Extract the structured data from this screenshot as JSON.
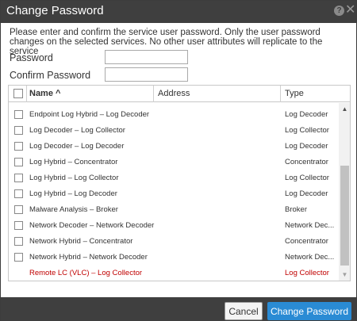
{
  "dialog": {
    "title": "Change Password",
    "intro": "Please enter and confirm the service user password. Only the user password changes on the selected services. No other user attributes will replicate to the service",
    "password_label": "Password",
    "confirm_password_label": "Confirm Password",
    "password_value": "",
    "confirm_password_value": ""
  },
  "grid": {
    "columns": {
      "name": "Name ^",
      "address": "Address",
      "type": "Type"
    },
    "rows": [
      {
        "name": "Endpoint Log Hybrid – Log Decoder",
        "type": "Log Decoder"
      },
      {
        "name": "Log Decoder – Log Collector",
        "type": "Log Collector"
      },
      {
        "name": "Log Decoder – Log Decoder",
        "type": "Log Decoder"
      },
      {
        "name": "Log Hybrid – Concentrator",
        "type": "Concentrator"
      },
      {
        "name": "Log Hybrid – Log Collector",
        "type": "Log Collector"
      },
      {
        "name": "Log Hybrid – Log Decoder",
        "type": "Log Decoder"
      },
      {
        "name": "Malware Analysis – Broker",
        "type": "Broker"
      },
      {
        "name": "Network Decoder – Network Decoder",
        "type": "Network Dec..."
      },
      {
        "name": "Network Hybrid – Concentrator",
        "type": "Concentrator"
      },
      {
        "name": "Network Hybrid – Network Decoder",
        "type": "Network Dec..."
      },
      {
        "name": "Remote LC (VLC) – Log Collector",
        "type": "Log Collector"
      }
    ]
  },
  "buttons": {
    "cancel": "Cancel",
    "change": "Change Password"
  },
  "colors": {
    "titlebar": "#3f3f3f",
    "primary_button": "#2a8bd4",
    "warning_text": "#c00000"
  }
}
